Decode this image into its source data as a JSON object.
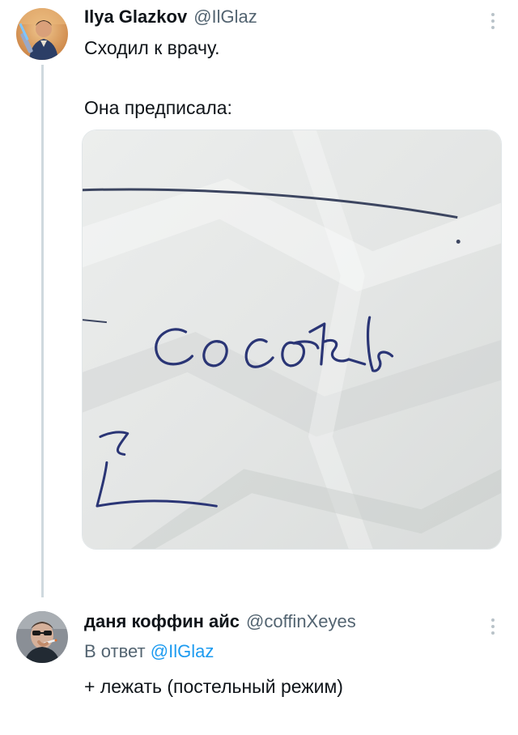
{
  "tweet": {
    "author_name": "Ilya Glazkov",
    "author_handle": "@IlGlaz",
    "text_line1": "Сходил к врачу.",
    "text_line2": "Она предписала:",
    "media_handwriting": "сосать"
  },
  "reply": {
    "author_name": "даня коффин айс",
    "author_handle": "@coffinXeyes",
    "reply_prefix": "В ответ",
    "reply_mention": "@IlGlaz",
    "text": "+ лежать (постельный режим)"
  },
  "icons": {
    "more": "more-vertical-icon"
  },
  "colors": {
    "text_primary": "#0f1419",
    "text_secondary": "#536471",
    "link": "#1d9bf0",
    "thread_line": "#cfd9de",
    "ink": "#2a3575"
  }
}
